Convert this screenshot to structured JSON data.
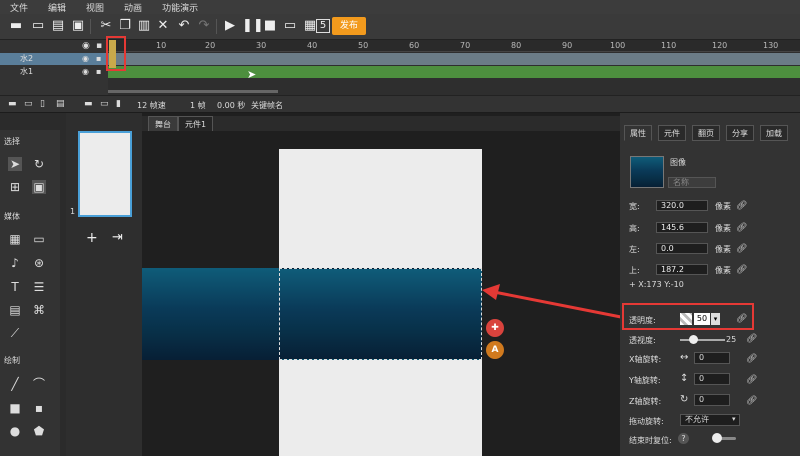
{
  "menu": [
    "文件",
    "编辑",
    "视图",
    "动画",
    "功能演示"
  ],
  "toolbar": {
    "publish_label": "发布"
  },
  "timeline": {
    "ticks": [
      "1",
      "10",
      "20",
      "30",
      "40",
      "50",
      "60",
      "70",
      "80",
      "90",
      "100",
      "110",
      "120",
      "130"
    ],
    "layers": [
      {
        "name": "水2",
        "selected": true
      },
      {
        "name": "水1",
        "selected": false
      }
    ],
    "fps": "12 帧速",
    "frame": "1 帧",
    "time": "0.00 秒",
    "keyframe_label": "关键帧名"
  },
  "tools": {
    "sections": [
      "选择",
      "媒体",
      "绘制"
    ]
  },
  "scenes": {
    "page_number": "1"
  },
  "tabs": [
    "舞台",
    "元件1"
  ],
  "properties": {
    "tabs": [
      "属性",
      "元件",
      "翻页",
      "分享",
      "加载"
    ],
    "type_label": "图像",
    "name_placeholder": "名称",
    "fields": [
      {
        "label": "宽:",
        "value": "320.0",
        "unit": "像素"
      },
      {
        "label": "高:",
        "value": "145.6",
        "unit": "像素"
      },
      {
        "label": "左:",
        "value": "0.0",
        "unit": "像素"
      },
      {
        "label": "上:",
        "value": "187.2",
        "unit": "像素"
      }
    ],
    "coords": "+ X:173   Y:-10",
    "opacity_label": "透明度:",
    "opacity_value": "50",
    "blur_label": "透视度:",
    "blur_value": "25",
    "x_rotate_label": "X轴旋转:",
    "x_rotate_value": "0",
    "y_rotate_label": "Y轴旋转:",
    "y_rotate_value": "0",
    "z_rotate_label": "Z轴旋转:",
    "z_rotate_value": "0",
    "drag_rotate_label": "拖动旋转:",
    "drag_rotate_value": "不允许",
    "reset_label": "结束时复位:"
  },
  "colors": {
    "accent": "#f29a1d",
    "highlight": "#e53935",
    "track_selected": "#6b7c87",
    "track_green": "#4d8f3e"
  }
}
